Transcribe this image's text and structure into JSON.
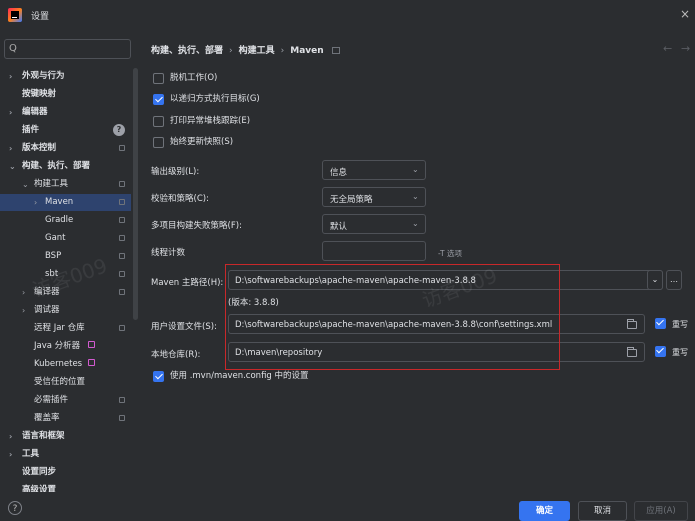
{
  "window": {
    "title": "设置",
    "close": "×"
  },
  "sidebar": {
    "search_glyph": "Q",
    "items": [
      {
        "label": "外观与行为",
        "arrow": "›"
      },
      {
        "label": "按键映射"
      },
      {
        "label": "编辑器",
        "arrow": "›"
      },
      {
        "label": "插件",
        "help": "?"
      },
      {
        "label": "版本控制",
        "arrow": "›"
      },
      {
        "label": "构建、执行、部署",
        "arrow": "⌄"
      },
      {
        "label": "构建工具",
        "arrow": "⌄"
      },
      {
        "label": "Maven",
        "arrow": "›"
      },
      {
        "label": "Gradle"
      },
      {
        "label": "Gant"
      },
      {
        "label": "BSP"
      },
      {
        "label": "sbt"
      },
      {
        "label": "编译器",
        "arrow": "›"
      },
      {
        "label": "调试器",
        "arrow": "›"
      },
      {
        "label": "远程 Jar 仓库"
      },
      {
        "label": "Java 分析器"
      },
      {
        "label": "Kubernetes"
      },
      {
        "label": "受信任的位置"
      },
      {
        "label": "必需插件"
      },
      {
        "label": "覆盖率"
      },
      {
        "label": "语言和框架",
        "arrow": "›"
      },
      {
        "label": "工具",
        "arrow": "›"
      },
      {
        "label": "设置同步"
      },
      {
        "label": "高级设置"
      }
    ]
  },
  "breadcrumb": {
    "parts": [
      "构建、执行、部署",
      "构建工具",
      "Maven"
    ],
    "separator": "›"
  },
  "nav": {
    "back": "←",
    "forward": "→"
  },
  "checkboxes": [
    {
      "label": "脱机工作(O)",
      "checked": false
    },
    {
      "label": "以递归方式执行目标(G)",
      "checked": true
    },
    {
      "label": "打印异常堆栈跟踪(E)",
      "checked": false
    },
    {
      "label": "始终更新快照(S)",
      "checked": false
    }
  ],
  "form": {
    "output_level": {
      "label": "输出级别(L):",
      "value": "信息"
    },
    "checksum_policy": {
      "label": "校验和策略(C):",
      "value": "无全局策略"
    },
    "failure_policy": {
      "label": "多项目构建失败策略(F):",
      "value": "默认"
    },
    "thread_count": {
      "label": "线程计数",
      "value": "",
      "hint": "-T 选项"
    },
    "maven_home": {
      "label": "Maven 主路径(H):",
      "value": "D:\\softwarebackups\\apache-maven\\apache-maven-3.8.8",
      "version": "(版本: 3.8.8)"
    },
    "user_settings": {
      "label": "用户设置文件(S):",
      "value": "D:\\softwarebackups\\apache-maven\\apache-maven-3.8.8\\conf\\settings.xml",
      "override": "重写"
    },
    "local_repo": {
      "label": "本地仓库(R):",
      "value": "D:\\maven\\repository",
      "override": "重写"
    },
    "use_mvn_config": {
      "label": "使用 .mvn/maven.config 中的设置",
      "checked": true
    },
    "chevron": "⌄",
    "maven_home_extra": "…"
  },
  "watermarks": [
    "访客009",
    "访客009"
  ],
  "footer": {
    "help": "?",
    "ok": "确定",
    "cancel": "取消",
    "apply": "应用(A)"
  },
  "colors": {
    "accent": "#3574f0",
    "highlight": "#c8282a",
    "selection": "#2e436e",
    "background": "#2b2d30"
  }
}
